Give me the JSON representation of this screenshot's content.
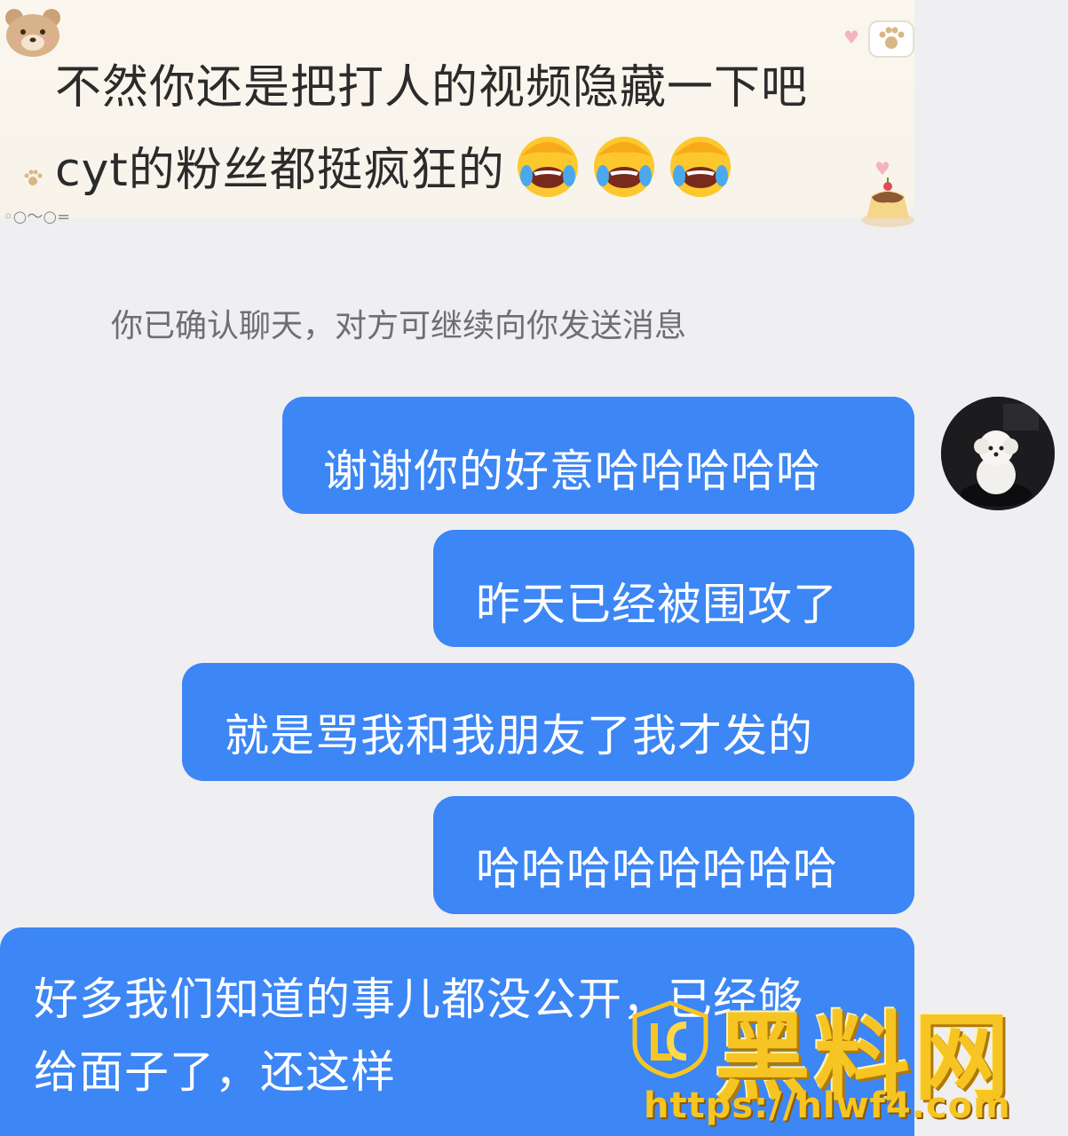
{
  "incoming_message": {
    "line1": "不然你还是把打人的视频隐藏一下吧",
    "line2": "cyt的粉丝都挺疯狂的",
    "emojis": [
      "facepalm-laugh-emoji",
      "facepalm-laugh-emoji",
      "facepalm-laugh-emoji"
    ],
    "background_color": "#f8f4eb"
  },
  "system_note": "你已确认聊天，对方可继续向你发送消息",
  "outgoing_messages": [
    {
      "text": "谢谢你的好意哈哈哈哈哈"
    },
    {
      "text": "昨天已经被围攻了"
    },
    {
      "text": "就是骂我和我朋友了我才发的"
    },
    {
      "text": "哈哈哈哈哈哈哈哈"
    },
    {
      "line1": "好多我们知道的事儿都没公开，已经够",
      "line2": "给面子了，还这样"
    }
  ],
  "bubble_color": "#3c86f5",
  "avatar": {
    "icon": "white-dog-avatar"
  },
  "watermark": {
    "title": "黑料网",
    "url": "https://hlwf4.com",
    "color": "#f7c523"
  }
}
